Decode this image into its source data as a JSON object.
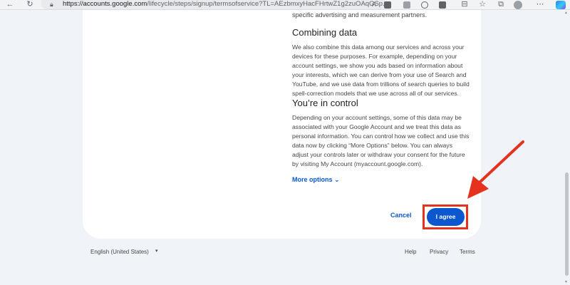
{
  "browser": {
    "url_host": "https://accounts.google.com",
    "url_path": "/lifecycle/steps/signup/termsofservice?TL=AEzbmxyHacFHrtwZ1g2zuOAqGSp...",
    "reader_label": "A",
    "icons": [
      "back-icon",
      "reload-icon",
      "lock-icon",
      "read-aloud-icon",
      "favorites-icon",
      "extensions-icon",
      "profile-icon",
      "copilot-icon"
    ]
  },
  "card": {
    "top_text": "specific advertising and measurement partners.",
    "section1": {
      "heading": "Combining data",
      "lines": [
        "We also combine this data among our services and across your",
        "devices for these purposes. For example, depending on your",
        "account settings, we show you ads based on information about",
        "your interests, which we can derive from your use of Search and",
        "YouTube, and we use data from trillions of search queries to build",
        "spell-correction models that we use across all of our services."
      ]
    },
    "section2": {
      "heading": "You’re in control",
      "lines": [
        "Depending on your account settings, some of this data may be",
        "associated with your Google Account and we treat this data as",
        "personal information. You can control how we collect and use this",
        "data now by clicking “More Options” below. You can always",
        "adjust your controls later or withdraw your consent for the future",
        "by visiting My Account (myaccount.google.com)."
      ]
    },
    "more_options_label": "More options",
    "cancel_label": "Cancel",
    "agree_label": "I agree"
  },
  "footer": {
    "language": "English (United States)",
    "help": "Help",
    "privacy": "Privacy",
    "terms": "Terms"
  },
  "colors": {
    "accent": "#0b57d0",
    "highlight": "#e5321f",
    "background": "#f0f4f9"
  }
}
